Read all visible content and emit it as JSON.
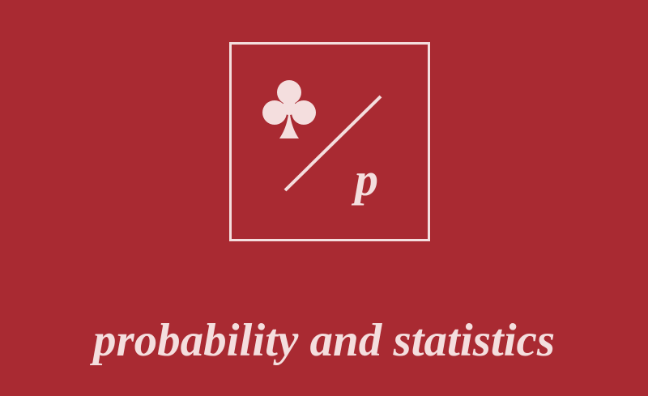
{
  "logo": {
    "icon": "club-icon",
    "letter": "p"
  },
  "tagline": "probability and statistics",
  "colors": {
    "background": "#a92a32",
    "foreground": "#f4dede"
  }
}
